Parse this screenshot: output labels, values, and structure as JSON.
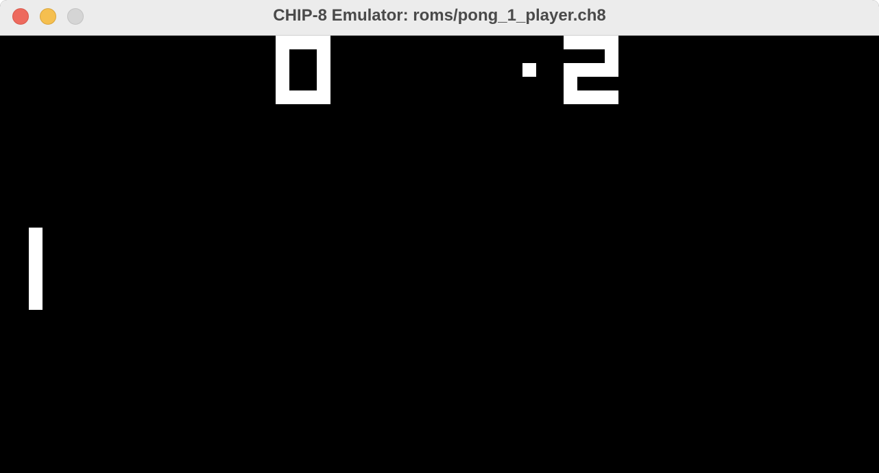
{
  "window": {
    "title": "CHIP-8 Emulator: roms/pong_1_player.ch8"
  },
  "traffic_lights": {
    "close_color": "#ed6a5e",
    "minimize_color": "#f5bf4f",
    "zoom_color": "#d5d5d5"
  },
  "game": {
    "player_score": "0",
    "cpu_score": "2",
    "foreground_color": "#ffffff",
    "background_color": "#000000"
  }
}
